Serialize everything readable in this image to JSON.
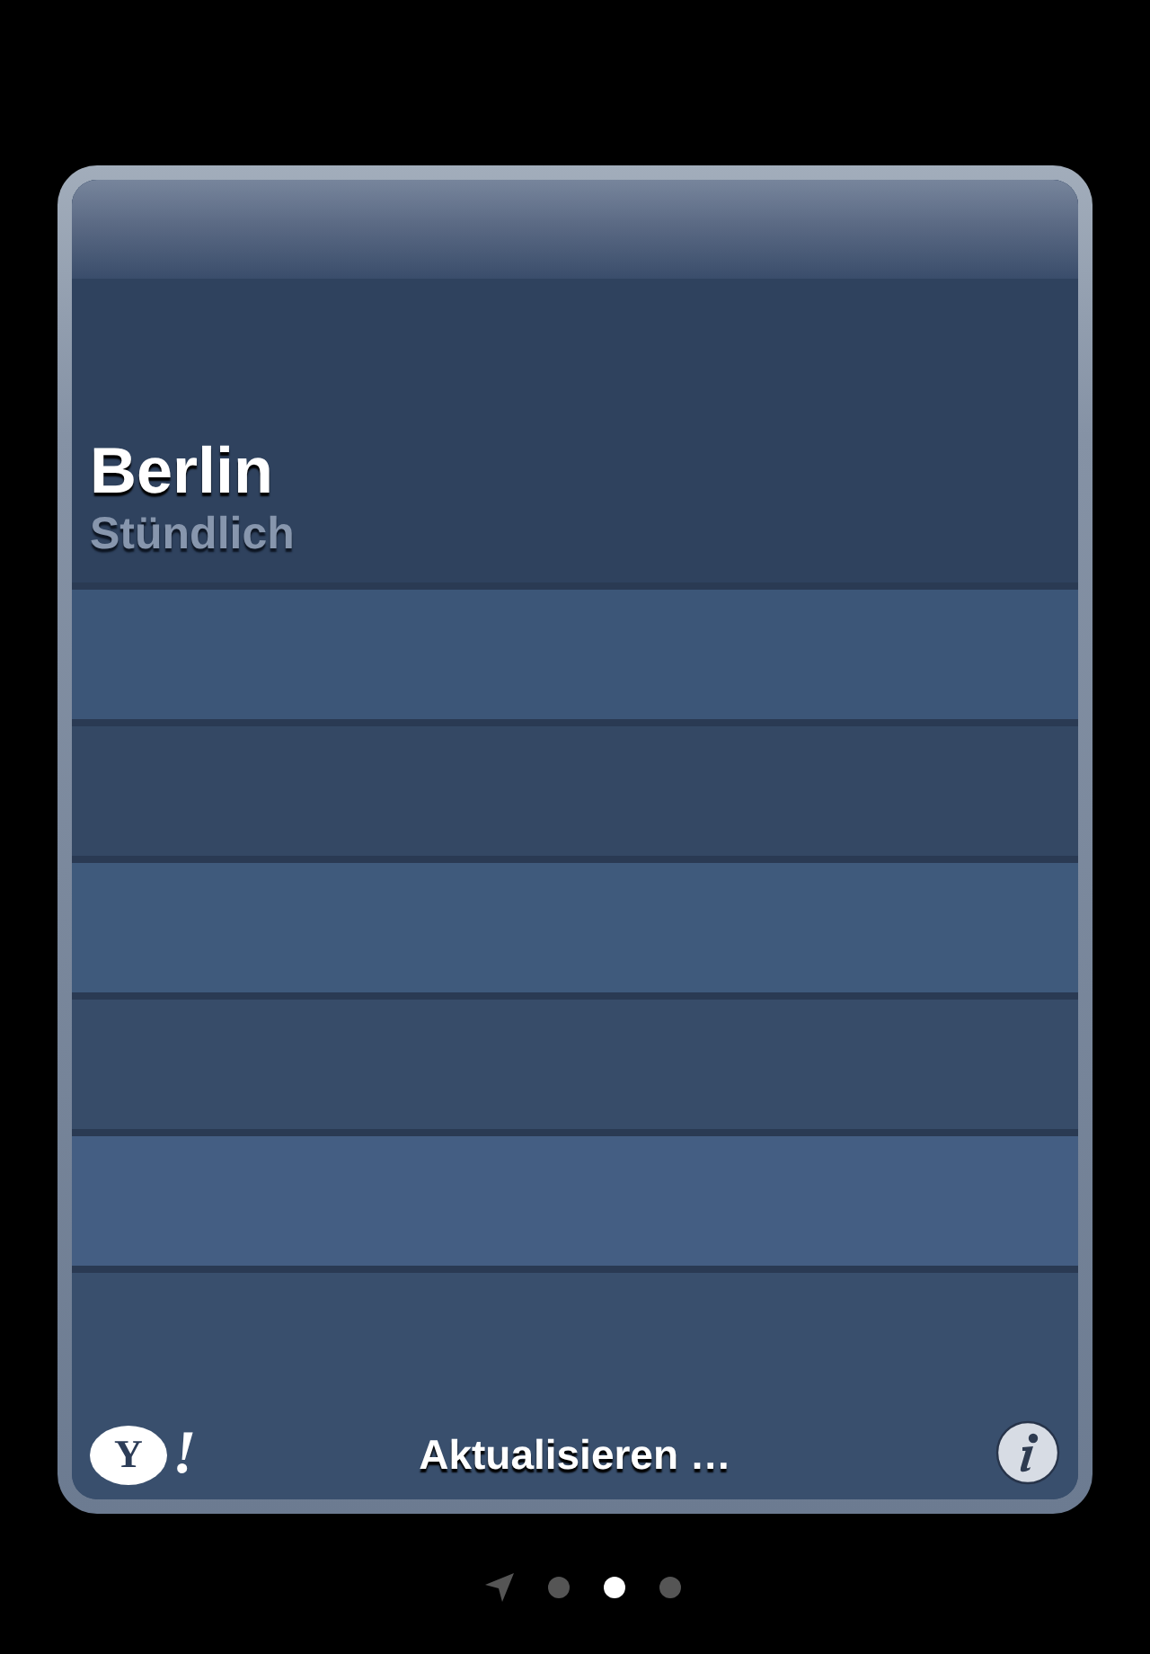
{
  "card": {
    "city": "Berlin",
    "mode": "Stündlich",
    "logo": {
      "letter": "Y",
      "mark": "!"
    },
    "status": "Aktualisieren …"
  },
  "page_indicator": [
    {
      "kind": "location",
      "selected": false
    },
    {
      "kind": "dot",
      "selected": false
    },
    {
      "kind": "dot",
      "selected": true
    },
    {
      "kind": "dot",
      "selected": false
    }
  ]
}
